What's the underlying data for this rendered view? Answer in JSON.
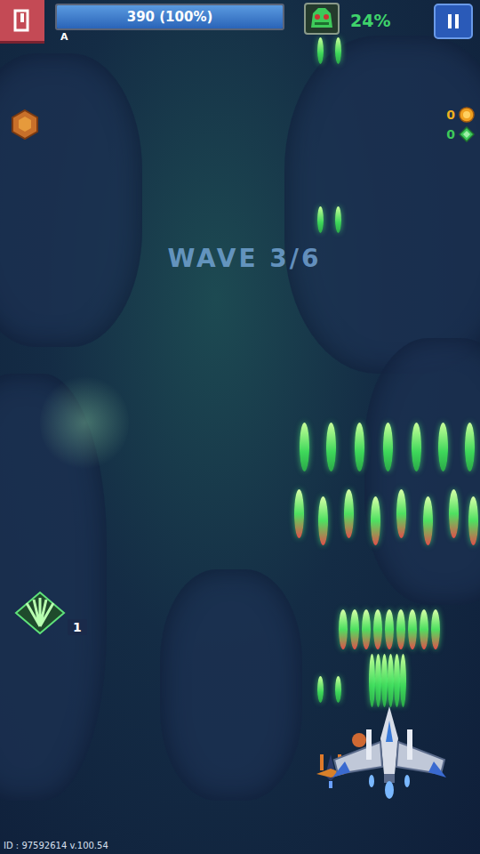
{
  "hud": {
    "health": {
      "text": "390 (100%)",
      "level": 1.0
    },
    "rank": "A",
    "boss_progress": {
      "text": "24%"
    }
  },
  "counters": [
    {
      "value": "0",
      "kind": "coin"
    },
    {
      "value": "0",
      "kind": "gem"
    }
  ],
  "wave": {
    "text": "WAVE 3/6"
  },
  "skill": {
    "count": "1"
  },
  "footer": {
    "id_text": "ID : 97592614 v.100.54"
  }
}
